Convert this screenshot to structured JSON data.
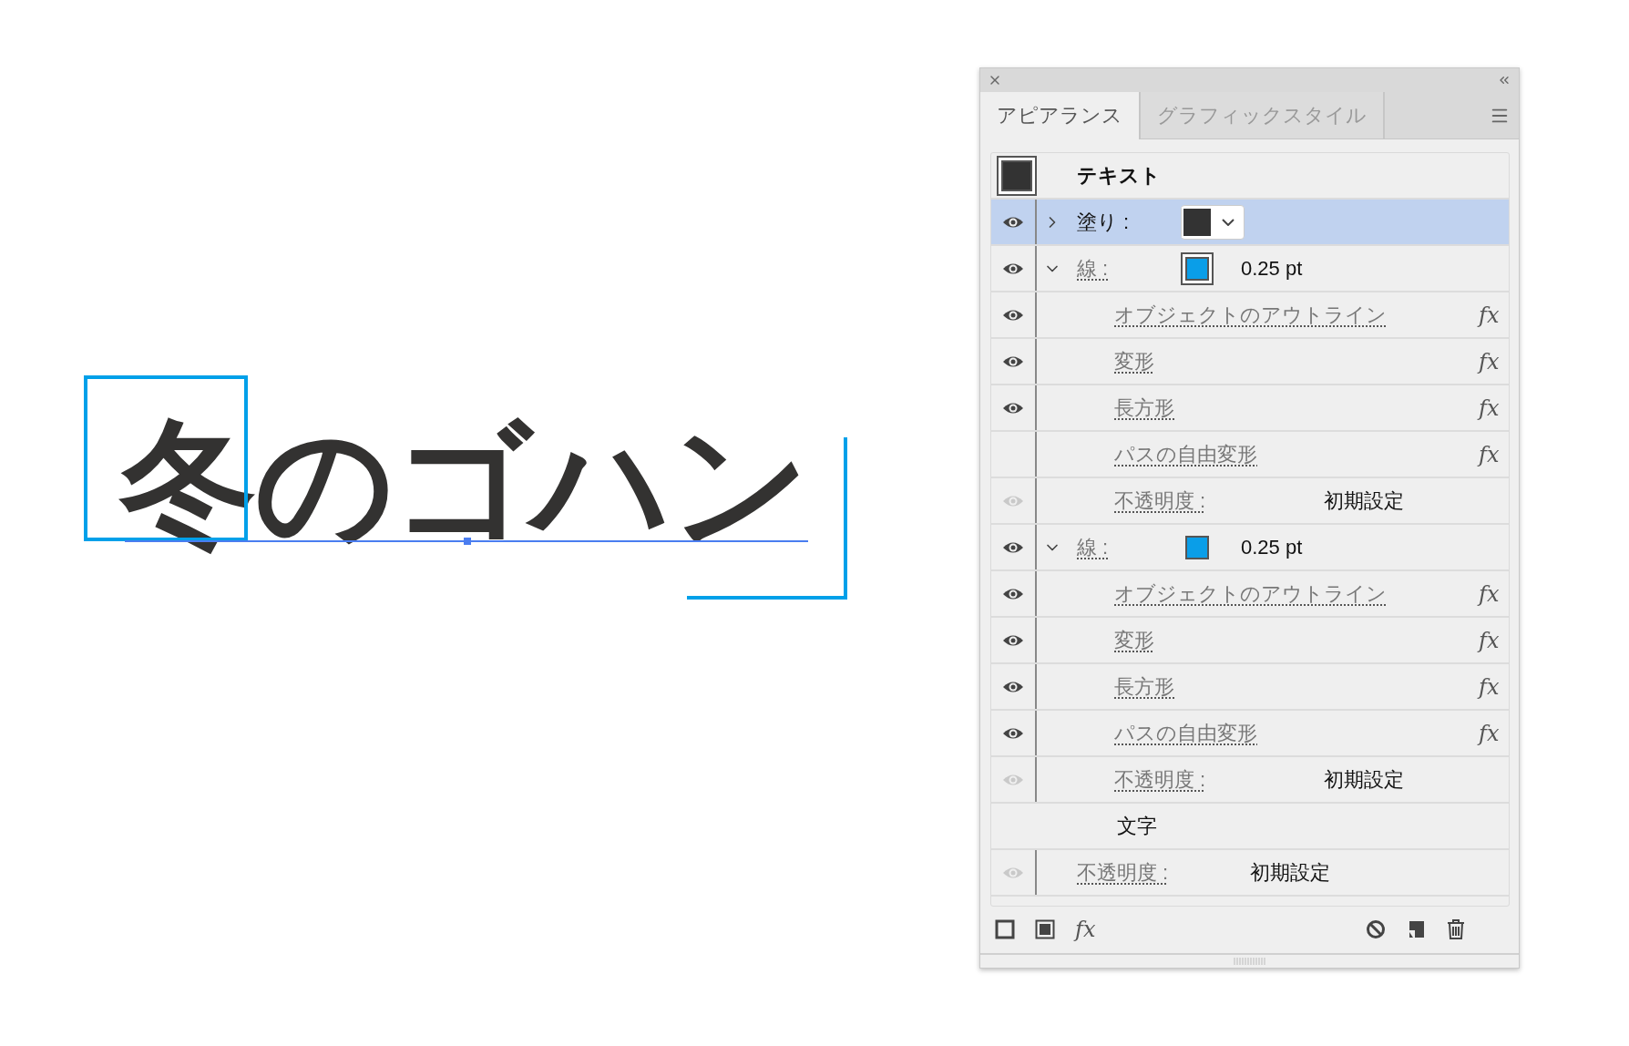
{
  "canvas": {
    "text": "冬のゴハン"
  },
  "panel": {
    "tabs": [
      {
        "label": "アピアランス",
        "selected": true
      },
      {
        "label": "グラフィックスタイル",
        "selected": false
      }
    ],
    "object": {
      "label": "テキスト"
    },
    "rows": [
      {
        "kind": "fill",
        "label": "塗り :",
        "visible": true,
        "dimmed": false,
        "expanded": false,
        "selected": true,
        "color": "#333333"
      },
      {
        "kind": "stroke",
        "label": "線 :",
        "visible": true,
        "dimmed": false,
        "expanded": true,
        "selected": false,
        "color": "#0a9ee8",
        "swatch_active": true,
        "value": "0.25 pt",
        "children": [
          {
            "kind": "effect",
            "label": "オブジェクトのアウトライン",
            "visible": true,
            "dimmed": false,
            "badge": "fx"
          },
          {
            "kind": "effect",
            "label": "変形",
            "visible": true,
            "dimmed": false,
            "badge": "fx"
          },
          {
            "kind": "effect",
            "label": "長方形",
            "visible": true,
            "dimmed": false,
            "badge": "fx"
          },
          {
            "kind": "effect",
            "label": "パスの自由変形",
            "visible": false,
            "badge": "fx"
          },
          {
            "kind": "opacity",
            "label": "不透明度 :",
            "visible": true,
            "dimmed": true,
            "value": "初期設定"
          }
        ]
      },
      {
        "kind": "stroke",
        "label": "線 :",
        "visible": true,
        "dimmed": false,
        "expanded": true,
        "selected": false,
        "color": "#0a9ee8",
        "swatch_active": false,
        "value": "0.25 pt",
        "children": [
          {
            "kind": "effect",
            "label": "オブジェクトのアウトライン",
            "visible": true,
            "dimmed": false,
            "badge": "fx"
          },
          {
            "kind": "effect",
            "label": "変形",
            "visible": true,
            "dimmed": false,
            "badge": "fx"
          },
          {
            "kind": "effect",
            "label": "長方形",
            "visible": true,
            "dimmed": false,
            "badge": "fx"
          },
          {
            "kind": "effect",
            "label": "パスの自由変形",
            "visible": true,
            "dimmed": false,
            "badge": "fx"
          },
          {
            "kind": "opacity",
            "label": "不透明度 :",
            "visible": true,
            "dimmed": true,
            "value": "初期設定"
          }
        ]
      },
      {
        "kind": "group",
        "label": "文字"
      },
      {
        "kind": "opacity",
        "label": "不透明度 :",
        "visible": true,
        "dimmed": true,
        "value": "初期設定"
      }
    ],
    "footer": {
      "fx_label": "fx"
    }
  }
}
